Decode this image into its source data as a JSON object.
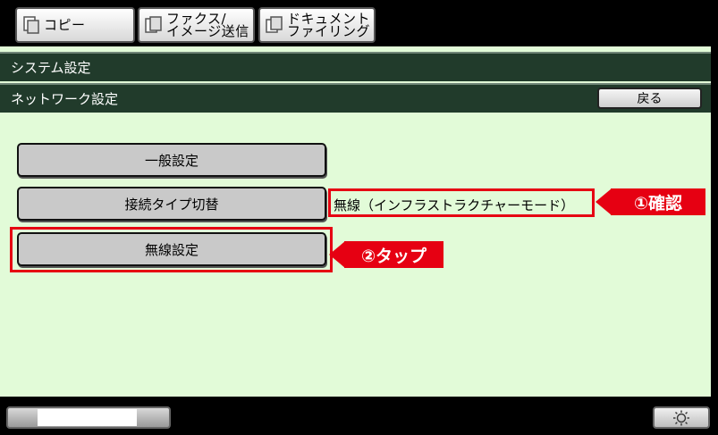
{
  "tabs": [
    {
      "label": "コピー",
      "icon": "copy-icon"
    },
    {
      "label": "ファクス/\nイメージ送信",
      "icon": "fax-icon"
    },
    {
      "label": "ドキュメント\nファイリング",
      "icon": "document-filing-icon"
    }
  ],
  "header": {
    "title": "システム設定",
    "subtitle": "ネットワーク設定",
    "back_label": "戻る"
  },
  "menu": {
    "general_label": "一般設定",
    "connection_label": "接続タイプ切替",
    "connection_value": "無線（インフラストラクチャーモード）",
    "wireless_label": "無線設定"
  },
  "callouts": {
    "confirm": "①確認",
    "tap": "②タップ"
  },
  "colors": {
    "screen_bg": "#e2fbd8",
    "header_bg": "#213b2b",
    "highlight": "#e60012"
  }
}
